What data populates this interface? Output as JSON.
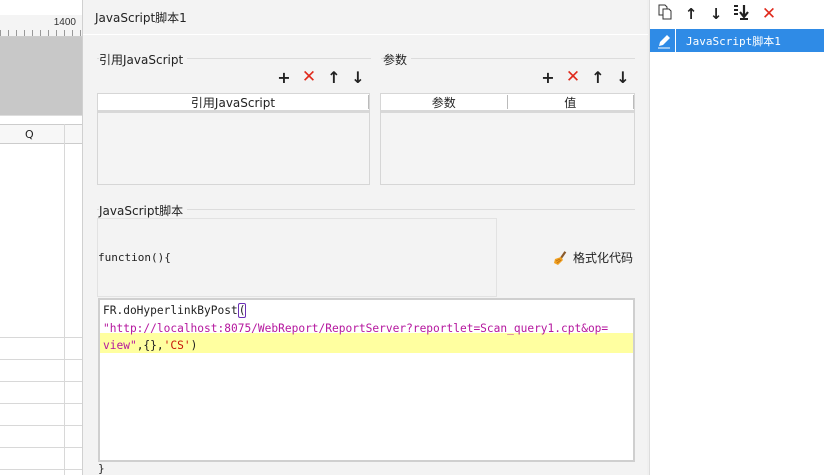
{
  "sheet": {
    "ruler_number": "1400",
    "column_label": "Q"
  },
  "dialog": {
    "title": "JavaScript脚本1",
    "ref_section": {
      "label": "引用JavaScript",
      "column_header": "引用JavaScript"
    },
    "params_section": {
      "label": "参数",
      "columns": [
        "参数",
        "值"
      ]
    },
    "script_section": {
      "label": "JavaScript脚本",
      "function_header": "function(){",
      "format_button": "格式化代码",
      "code_line1": "FR.doHyperlinkByPost",
      "code_open_paren": "(",
      "code_line2": "\"http://localhost:8075/WebReport/ReportServer?reportlet=Scan_query1.cpt&op=",
      "code_line3_str": "view\"",
      "code_line3_mid": ",{},",
      "code_line3_sq": "'CS'",
      "code_line3_end": ")",
      "closing_brace": "}"
    }
  },
  "right_panel": {
    "items": [
      {
        "label": "JavaScript脚本1",
        "selected": true
      }
    ]
  },
  "icons": [
    "add-icon",
    "delete-icon",
    "arrow-up-icon",
    "arrow-down-icon",
    "copy-icon",
    "move-bottom-icon",
    "edit-icon",
    "broom-icon"
  ],
  "colors": {
    "accent_selected": "#2f8be6",
    "delete_red": "#e02a1c",
    "highlight_line": "#ffffa0",
    "string_magenta": "#b5179e"
  }
}
